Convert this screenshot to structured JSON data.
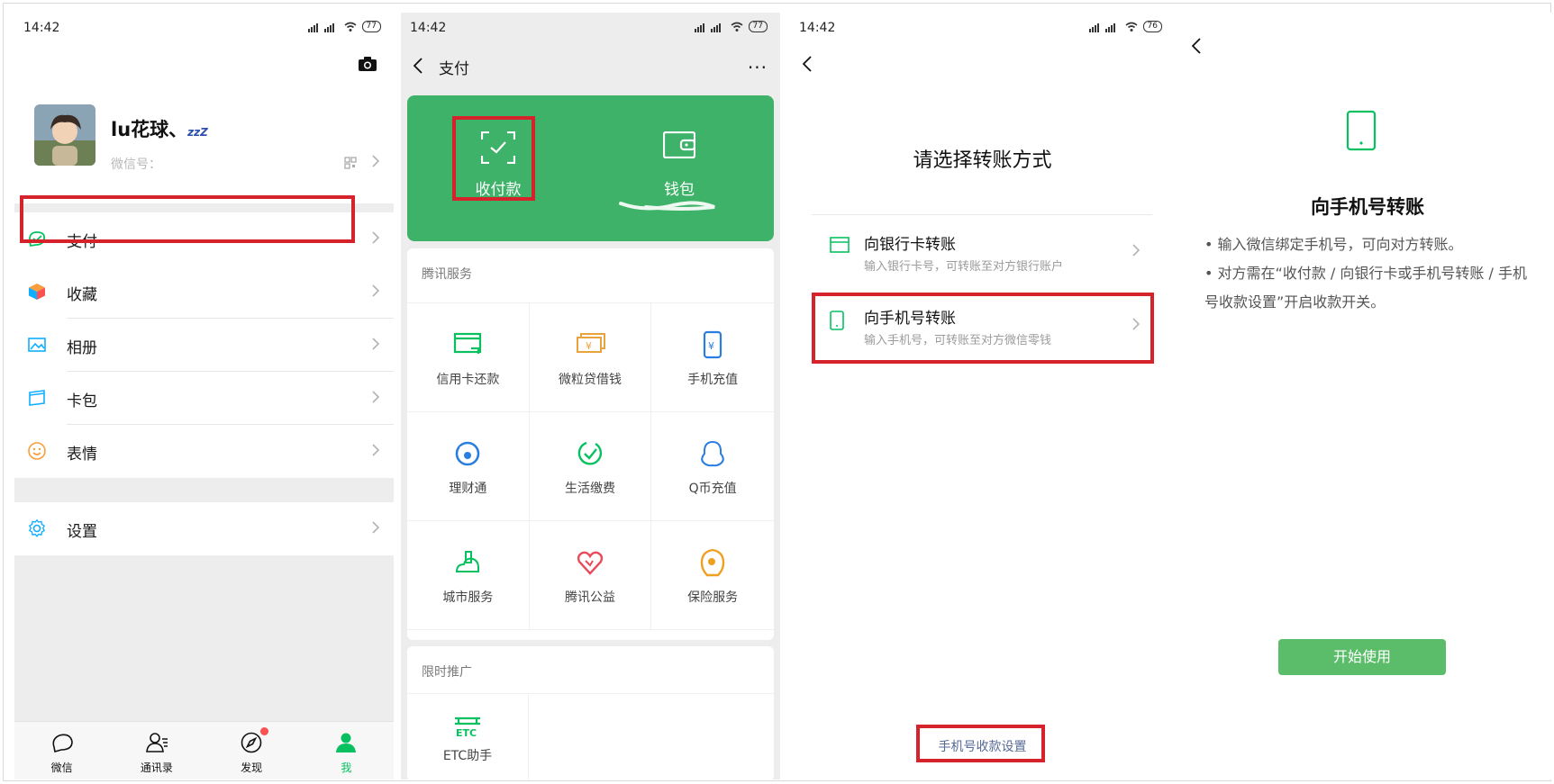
{
  "status_time": "14:42",
  "status_battery_1": "77",
  "status_battery_2": "77",
  "status_battery_3": "76",
  "colors": {
    "wechat_green": "#07c160",
    "banner_green": "#3fb26a",
    "highlight_red": "#d6222a",
    "link_blue": "#576b95"
  },
  "me": {
    "nickname": "lu花球、",
    "zzz": "zzZ",
    "wechat_id_label": "微信号：",
    "menu": [
      {
        "label": "支付",
        "icon": "pay-icon"
      },
      {
        "label": "收藏",
        "icon": "favorites-cube-icon"
      },
      {
        "label": "相册",
        "icon": "album-icon"
      },
      {
        "label": "卡包",
        "icon": "card-wallet-icon"
      },
      {
        "label": "表情",
        "icon": "emoji-icon"
      },
      {
        "label": "设置",
        "icon": "gear-icon"
      }
    ],
    "tabs": [
      {
        "label": "微信",
        "icon": "chat-bubble-icon"
      },
      {
        "label": "通讯录",
        "icon": "contacts-icon"
      },
      {
        "label": "发现",
        "icon": "compass-icon"
      },
      {
        "label": "我",
        "icon": "person-icon"
      }
    ]
  },
  "pay": {
    "title": "支付",
    "more": "···",
    "banner": [
      {
        "label": "收付款",
        "icon": "scan-check-icon"
      },
      {
        "label": "钱包",
        "icon": "wallet-icon"
      }
    ],
    "section_title": "腾讯服务",
    "services": [
      {
        "label": "信用卡还款",
        "icon": "credit-card-icon"
      },
      {
        "label": "微粒贷借钱",
        "icon": "loan-icon"
      },
      {
        "label": "手机充值",
        "icon": "phone-topup-icon"
      },
      {
        "label": "理财通",
        "icon": "wealth-icon"
      },
      {
        "label": "生活缴费",
        "icon": "bill-payment-icon"
      },
      {
        "label": "Q币充值",
        "icon": "qq-penguin-icon"
      },
      {
        "label": "城市服务",
        "icon": "city-service-icon"
      },
      {
        "label": "腾讯公益",
        "icon": "charity-heart-icon"
      },
      {
        "label": "保险服务",
        "icon": "insurance-icon"
      }
    ],
    "promo_title": "限时推广",
    "promo": [
      {
        "label": "ETC助手",
        "icon": "etc-icon"
      }
    ]
  },
  "transfer": {
    "heading": "请选择转账方式",
    "options": [
      {
        "title": "向银行卡转账",
        "subtitle": "输入银行卡号，可转账至对方银行账户",
        "icon": "bank-card-icon"
      },
      {
        "title": "向手机号转账",
        "subtitle": "输入手机号，可转账至对方微信零钱",
        "icon": "phone-icon"
      }
    ],
    "bottom_link": "手机号收款设置"
  },
  "phone_transfer": {
    "heading": "向手机号转账",
    "bullet_1": "• 输入微信绑定手机号，可向对方转账。",
    "bullet_2": "• 对方需在“收付款 / 向银行卡或手机号转账 / 手机号收款设置”开启收款开关。",
    "button": "开始使用"
  }
}
